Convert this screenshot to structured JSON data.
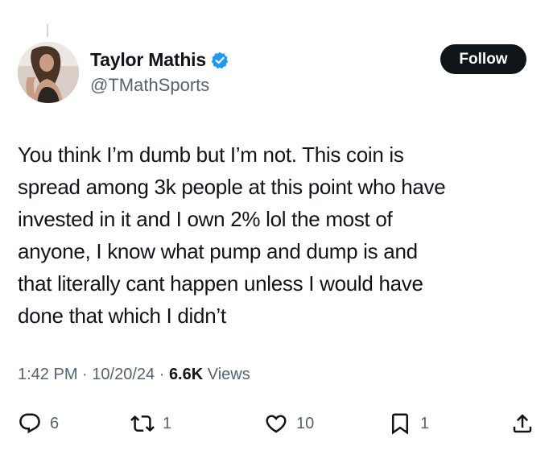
{
  "author": {
    "display_name": "Taylor Mathis",
    "handle": "@TMathSports",
    "verified": true
  },
  "follow_label": "Follow",
  "tweet": {
    "text_lines": [
      "You think I’m dumb but I’m not. This coin is",
      "spread among 3k people at this point who have",
      "invested in it and I own 2% lol the most of",
      "anyone, I know what pump and dump is and",
      "that literally cant happen unless I would have",
      "done that which I didn’t"
    ]
  },
  "meta": {
    "time": "1:42 PM",
    "separator": "·",
    "date": "10/20/24",
    "views_count": "6.6K",
    "views_label": "Views"
  },
  "actions": {
    "replies": "6",
    "reposts": "1",
    "likes": "10",
    "bookmarks": "1"
  },
  "colors": {
    "text": "#0f1419",
    "secondary": "#536471",
    "verified": "#1d9bf0",
    "follow_bg": "#0f1419"
  },
  "icons": [
    "verified-badge-icon",
    "reply-icon",
    "repost-icon",
    "like-icon",
    "bookmark-icon",
    "share-icon"
  ]
}
